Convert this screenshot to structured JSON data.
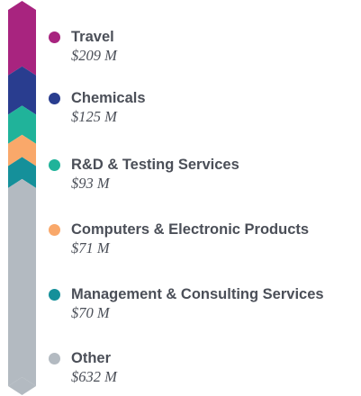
{
  "chart_data": {
    "type": "stacked-bar",
    "unit": "$ M",
    "categories": [
      "Travel",
      "Chemicals",
      "R&D & Testing Services",
      "Computers & Electronic Products",
      "Management & Consulting Services",
      "Other"
    ],
    "values": [
      209,
      125,
      93,
      71,
      70,
      632
    ],
    "value_labels": [
      "$209 M",
      "$125 M",
      "$93 M",
      "$71 M",
      "$70 M",
      "$632 M"
    ],
    "colors": [
      "#a8247f",
      "#293d8f",
      "#20b39a",
      "#f9a86a",
      "#15909a",
      "#b3bac1"
    ],
    "legend": "right",
    "grid": false
  }
}
